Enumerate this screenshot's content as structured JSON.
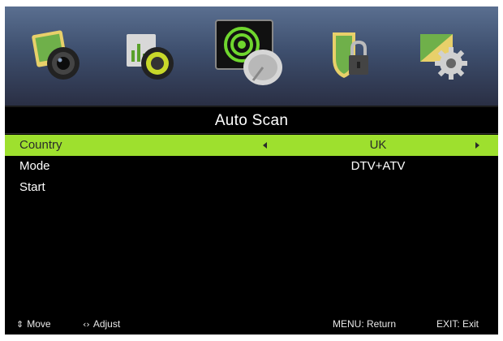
{
  "icons": [
    {
      "name": "picture-icon",
      "selected": false
    },
    {
      "name": "sound-icon",
      "selected": false
    },
    {
      "name": "channel-icon",
      "selected": true
    },
    {
      "name": "lock-icon",
      "selected": false
    },
    {
      "name": "setup-icon",
      "selected": false
    }
  ],
  "title": "Auto Scan",
  "rows": [
    {
      "label": "Country",
      "value": "UK"
    },
    {
      "label": "Mode",
      "value": "DTV+ATV"
    },
    {
      "label": "Start",
      "value": ""
    }
  ],
  "footer": {
    "move_glyph": "⇕",
    "move_label": "Move",
    "adjust_glyph": "‹›",
    "adjust_label": "Adjust",
    "return_label": "MENU: Return",
    "exit_label": "EXIT: Exit"
  },
  "colors": {
    "highlight": "#9ee02e",
    "background": "#000000",
    "icon_bar": "#3e4f6e"
  }
}
